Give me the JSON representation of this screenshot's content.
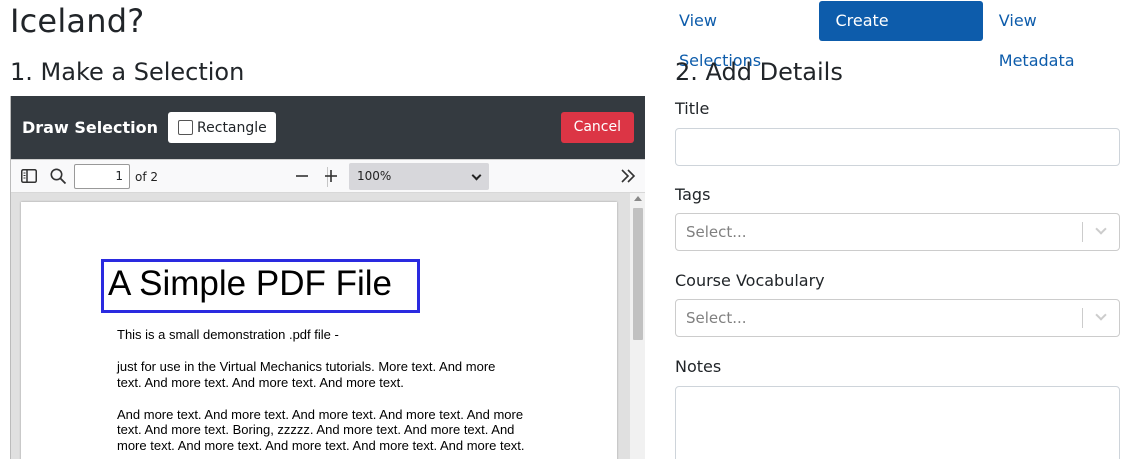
{
  "page": {
    "title": "Iceland?"
  },
  "nav": {
    "view_selections": "View Selections",
    "create_selection": "Create Selection",
    "view_metadata": "View Metadata"
  },
  "left": {
    "heading": "1. Make a Selection",
    "toolbar": {
      "title": "Draw Selection",
      "rectangle_label": "Rectangle",
      "rectangle_checked": false,
      "cancel_label": "Cancel"
    },
    "pdf_toolbar": {
      "page_value": "1",
      "page_count": "of 2",
      "zoom": "100%"
    },
    "pdf": {
      "heading": "A Simple PDF File",
      "lines": [
        "This is a small demonstration .pdf file -",
        "just for use in the Virtual Mechanics tutorials. More text. And more",
        "text. And more text. And more text. And more text.",
        "And more text. And more text. And more text. And more text. And more",
        "text. And more text. Boring, zzzzz. And more text. And more text. And",
        "more text. And more text. And more text. And more text. And more text."
      ]
    }
  },
  "right": {
    "heading": "2. Add Details",
    "title_label": "Title",
    "title_value": "",
    "tags_label": "Tags",
    "tags_placeholder": "Select...",
    "vocab_label": "Course Vocabulary",
    "vocab_placeholder": "Select...",
    "notes_label": "Notes",
    "notes_value": ""
  },
  "icons": {
    "sidebar": "sidebar-toggle-icon",
    "search": "search-icon",
    "zoom_out": "minus-icon",
    "zoom_in": "plus-icon",
    "tools": "double-chevron-right-icon"
  },
  "colors": {
    "primary": "#0d5cab",
    "danger": "#dc3545",
    "toolbar_dark": "#343a40",
    "selection_outline": "#2a2ae0"
  }
}
